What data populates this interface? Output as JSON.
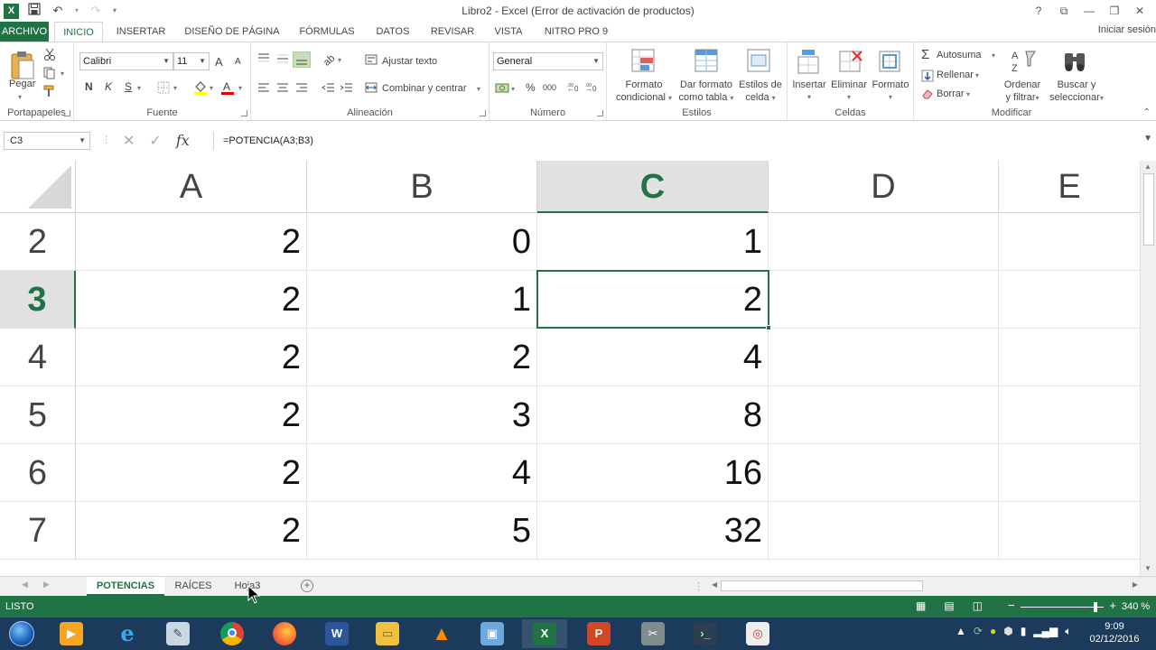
{
  "window": {
    "title": "Libro2 - Excel (Error de activación de productos)",
    "controls": [
      "?",
      "⧉",
      "—",
      "❐",
      "✕"
    ]
  },
  "ribbon_tabs": [
    "ARCHIVO",
    "INICIO",
    "INSERTAR",
    "DISEÑO DE PÁGINA",
    "FÓRMULAS",
    "DATOS",
    "REVISAR",
    "VISTA",
    "NITRO PRO 9"
  ],
  "active_tab": "INICIO",
  "signin": "Iniciar sesión",
  "ribbon": {
    "clipboard": {
      "label": "Portapapeles",
      "paste": "Pegar"
    },
    "font": {
      "label": "Fuente",
      "font_name": "Calibri",
      "font_size": "11",
      "bold": "N",
      "italic": "K",
      "underline": "S",
      "grow": "A",
      "shrink": "A"
    },
    "alignment": {
      "label": "Alineación",
      "wrap": "Ajustar texto",
      "merge": "Combinar y centrar"
    },
    "number": {
      "label": "Número",
      "format": "General",
      "percent": "%",
      "thousands": "000"
    },
    "styles": {
      "label": "Estilos",
      "conditional": [
        "Formato",
        "condicional"
      ],
      "table": [
        "Dar formato",
        "como tabla"
      ],
      "cell_styles": [
        "Estilos de",
        "celda"
      ]
    },
    "cells": {
      "label": "Celdas",
      "insert": "Insertar",
      "delete": "Eliminar",
      "format": "Formato"
    },
    "editing": {
      "label": "Modificar",
      "autosum": "Autosuma",
      "fill": "Rellenar",
      "clear": "Borrar",
      "sort": [
        "Ordenar",
        "y filtrar"
      ],
      "find": [
        "Buscar y",
        "seleccionar"
      ]
    }
  },
  "formula_bar": {
    "name_box": "C3",
    "formula": "=POTENCIA(A3;B3)"
  },
  "sheet": {
    "columns": [
      "A",
      "B",
      "C",
      "D",
      "E"
    ],
    "selected_column": "C",
    "selected_row": "3",
    "rows": [
      {
        "num": "2",
        "cells": [
          "2",
          "0",
          "1",
          "",
          ""
        ]
      },
      {
        "num": "3",
        "cells": [
          "2",
          "1",
          "2",
          "",
          ""
        ]
      },
      {
        "num": "4",
        "cells": [
          "2",
          "2",
          "4",
          "",
          ""
        ]
      },
      {
        "num": "5",
        "cells": [
          "2",
          "3",
          "8",
          "",
          ""
        ]
      },
      {
        "num": "6",
        "cells": [
          "2",
          "4",
          "16",
          "",
          ""
        ]
      },
      {
        "num": "7",
        "cells": [
          "2",
          "5",
          "32",
          "",
          ""
        ]
      }
    ]
  },
  "sheet_tabs": [
    "POTENCIAS",
    "RAÍCES",
    "Hoja3"
  ],
  "active_sheet": "POTENCIAS",
  "status": {
    "text": "LISTO",
    "zoom": "340 %",
    "zoom_level_percent": 340
  },
  "taskbar": {
    "apps": [
      "media-player",
      "internet-explorer",
      "paint",
      "chrome",
      "firefox",
      "word",
      "file-explorer",
      "vlc",
      "network",
      "excel",
      "powerpoint",
      "tool",
      "terminal",
      "browser"
    ],
    "active_app": "excel",
    "time": "9:09",
    "date": "02/12/2016"
  },
  "colors": {
    "accent": "#217346",
    "taskbar": "#1c3b5c"
  }
}
